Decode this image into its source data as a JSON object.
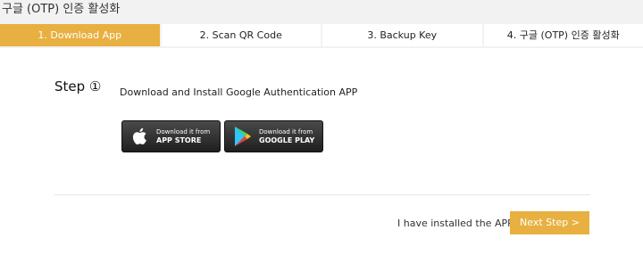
{
  "page": {
    "title": "구글 (OTP) 인증 활성화"
  },
  "tabs": [
    {
      "label": "1. Download App"
    },
    {
      "label": "2. Scan QR Code"
    },
    {
      "label": "3. Backup Key"
    },
    {
      "label": "4. 구글 (OTP) 인증 활성화"
    }
  ],
  "active_tab_index": 0,
  "step": {
    "label": "Step ①",
    "instruction": "Download and Install Google Authentication APP"
  },
  "store_buttons": {
    "app_store": {
      "small": "Download it from",
      "big": "APP STORE",
      "icon": "apple-icon"
    },
    "google_play": {
      "small": "Download it from",
      "big": "GOOGLE PLAY",
      "icon": "google-play-icon"
    }
  },
  "footer": {
    "installed_text": "I have installed the APP",
    "next_label": "Next Step >"
  },
  "colors": {
    "accent": "#e8b040",
    "background": "#f2f2f2",
    "panel": "#ffffff"
  }
}
